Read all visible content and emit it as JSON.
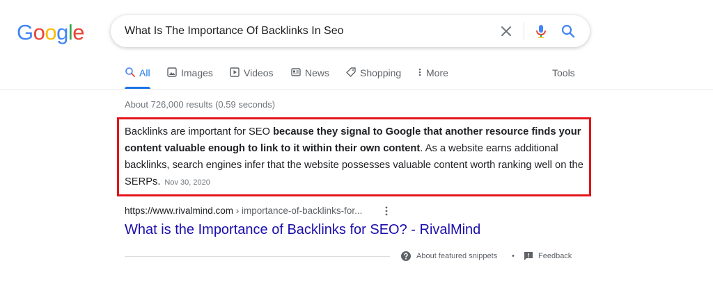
{
  "logo": {
    "letters": [
      "G",
      "o",
      "o",
      "g",
      "l",
      "e"
    ],
    "colors": [
      "#4285f4",
      "#ea4335",
      "#fbbc05",
      "#4285f4",
      "#34a853",
      "#ea4335"
    ]
  },
  "search": {
    "query": "What Is The Importance Of Backlinks In Seo",
    "clear_icon": "close-icon",
    "mic_icon": "mic-icon",
    "search_icon": "search-icon"
  },
  "tabs": [
    {
      "label": "All",
      "icon": "search-icon",
      "active": true
    },
    {
      "label": "Images",
      "icon": "image-icon",
      "active": false
    },
    {
      "label": "Videos",
      "icon": "video-icon",
      "active": false
    },
    {
      "label": "News",
      "icon": "news-icon",
      "active": false
    },
    {
      "label": "Shopping",
      "icon": "tag-icon",
      "active": false
    },
    {
      "label": "More",
      "icon": "more-vert-icon",
      "active": false
    }
  ],
  "tools_label": "Tools",
  "stats": "About 726,000 results (0.59 seconds)",
  "snippet": {
    "text_before": "Backlinks are important for SEO ",
    "text_bold": "because they signal to Google that another resource finds your content valuable enough to link to it within their own content",
    "text_after": ". As a website earns additional backlinks, search engines infer that the website possesses valuable content worth ranking well on the SERPs.",
    "date": "Nov 30, 2020",
    "highlight_color": "#e3131a"
  },
  "result": {
    "cite_host": "https://www.rivalmind.com",
    "cite_path": " › importance-of-backlinks-for...",
    "title": "What is the Importance of Backlinks for SEO? - RivalMind"
  },
  "footer": {
    "about": "About featured snippets",
    "separator": "•",
    "feedback": "Feedback"
  },
  "colors": {
    "accent": "#1a73e8",
    "link": "#1a0dab"
  }
}
